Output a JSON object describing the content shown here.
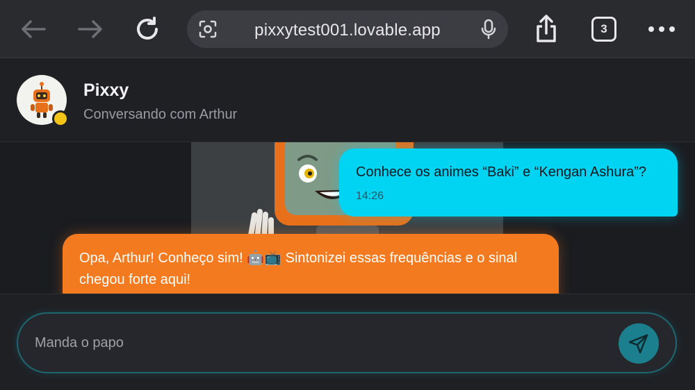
{
  "browser": {
    "url": "pixxytest001.lovable.app",
    "tab_count": "3",
    "icons": [
      "back-arrow-icon",
      "forward-arrow-icon",
      "reload-icon",
      "lens-icon",
      "mic-icon",
      "share-icon",
      "more-icon"
    ]
  },
  "chat": {
    "bot_name": "Pixxy",
    "subtitle": "Conversando com Arthur",
    "status_color": "#f3c316"
  },
  "messages": [
    {
      "sender": "user",
      "text": "Conhece os animes “Baki” e “Kengan Ashura”?",
      "time": "14:26",
      "color": "#00d4f2"
    },
    {
      "sender": "bot",
      "text": "Opa, Arthur! Conheço sim! 🤖📺 Sintonizei essas frequências e o sinal chegou forte aqui!",
      "color": "#f47a1f"
    }
  ],
  "composer": {
    "placeholder": "Manda o papo",
    "value": ""
  },
  "colors": {
    "accent_cyan": "#00d4f2",
    "accent_orange": "#f47a1f",
    "send_button": "#1b7f8d"
  }
}
